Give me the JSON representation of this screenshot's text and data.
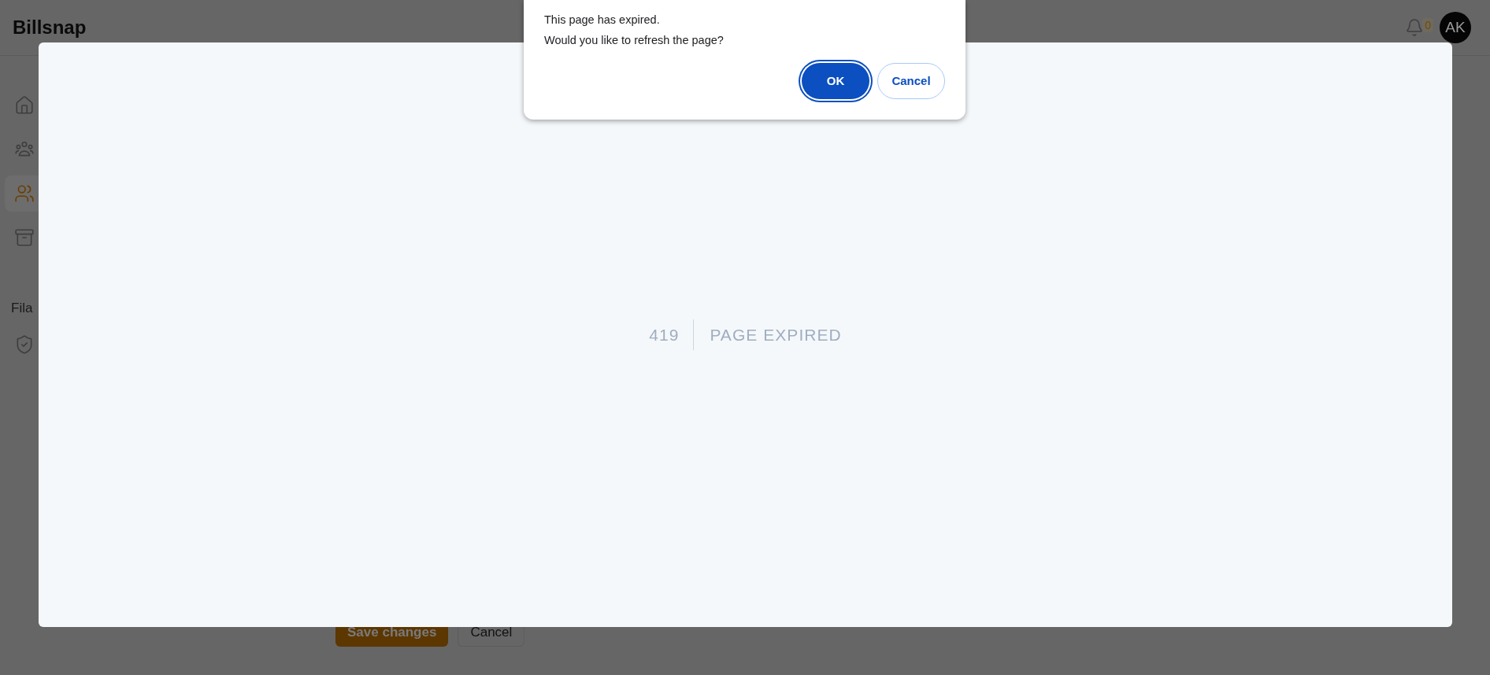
{
  "app": {
    "logo": "Billsnap",
    "notifications": {
      "count": "0"
    },
    "avatar": {
      "initials": "AK"
    }
  },
  "sidebar": {
    "items": [
      {
        "kind": "home",
        "selected": false
      },
      {
        "kind": "group",
        "selected": false
      },
      {
        "kind": "users",
        "selected": true
      },
      {
        "kind": "archive",
        "selected": false
      }
    ],
    "section_label": "Fila",
    "section_items": [
      {
        "kind": "shield",
        "selected": false
      }
    ]
  },
  "form_actions": [
    "Save changes",
    "Cancel"
  ],
  "error_panel": {
    "code": "419",
    "message": "PAGE EXPIRED"
  },
  "dialog": {
    "lines": [
      "This page has expired.",
      "Would you like to refresh the page?"
    ],
    "buttons": [
      {
        "kind": "primary",
        "label": "OK",
        "focused": true
      },
      {
        "kind": "secondary",
        "label": "Cancel",
        "focused": false
      }
    ]
  }
}
